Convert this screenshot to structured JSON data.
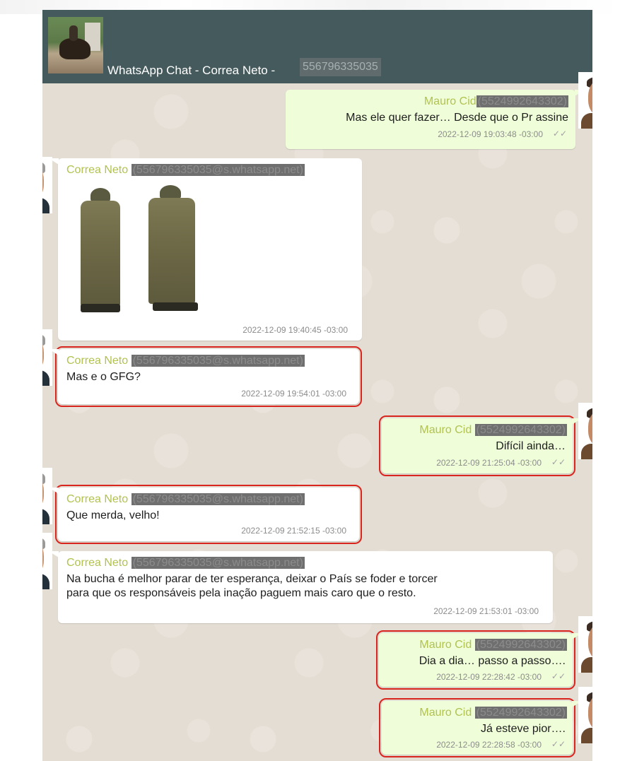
{
  "header": {
    "title": "WhatsApp Chat - Correa Neto - ",
    "phone": "556796335035"
  },
  "messages": [
    {
      "sender_name": "Mauro Cid",
      "sender_id": "(5524992643302)",
      "text": "Mas ele quer fazer… Desde que o Pr assine",
      "timestamp": "2022-12-09 19:03:48 -03:00",
      "ticks": "✓✓"
    },
    {
      "sender_name": "Correa Neto ",
      "sender_id": "(556796335035@s.whatsapp.net)",
      "timestamp": "2022-12-09 19:40:45 -03:00"
    },
    {
      "sender_name": "Correa Neto ",
      "sender_id": "(556796335035@s.whatsapp.net)",
      "text": "Mas e o GFG?",
      "timestamp": "2022-12-09 19:54:01 -03:00"
    },
    {
      "sender_name": "Mauro Cid ",
      "sender_id": "(5524992643302)",
      "text": "Difícil ainda…",
      "timestamp": "2022-12-09 21:25:04 -03:00",
      "ticks": "✓✓"
    },
    {
      "sender_name": "Correa Neto ",
      "sender_id": "(556796335035@s.whatsapp.net)",
      "text": "Que merda, velho!",
      "timestamp": "2022-12-09 21:52:15 -03:00"
    },
    {
      "sender_name": "Correa Neto ",
      "sender_id": "(556796335035@s.whatsapp.net)",
      "text_line1": "Na bucha é melhor parar de ter esperança, deixar o País se foder e torcer",
      "text_line2": "para que os responsáveis pela inação paguem mais caro que o resto.",
      "timestamp": "2022-12-09 21:53:01 -03:00"
    },
    {
      "sender_name": "Mauro Cid ",
      "sender_id": "(5524992643302)",
      "text": "Dia a dia… passo a passo….",
      "timestamp": "2022-12-09 22:28:42 -03:00",
      "ticks": "✓✓"
    },
    {
      "sender_name": "Mauro Cid ",
      "sender_id": "(5524992643302)",
      "text": "Já esteve pior….",
      "timestamp": "2022-12-09 22:28:58 -03:00",
      "ticks": "✓✓"
    }
  ]
}
